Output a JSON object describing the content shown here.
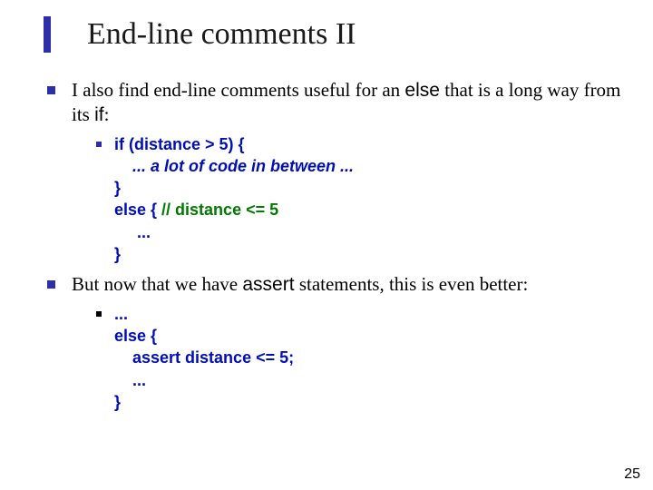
{
  "title": "End-line comments II",
  "p1_a": "I also find end-line comments useful for an ",
  "p1_code1": "else",
  "p1_b": " that is a long way from its ",
  "p1_code2": "if",
  "p1_c": ":",
  "code1": {
    "l1": "if (distance > 5) {",
    "l2": "    ... a lot of code in between ...",
    "l3": "}",
    "l4a": "else { ",
    "l4b": "// distance <= 5",
    "l5": "     ...",
    "l6": "}"
  },
  "p2_a": "But now that we have ",
  "p2_code": "assert",
  "p2_b": " statements, this is even better:",
  "code2": {
    "l1": "...",
    "l2": "else {",
    "l3": "    assert distance <= 5;",
    "l4": "    ...",
    "l5": "}"
  },
  "page_number": "25"
}
